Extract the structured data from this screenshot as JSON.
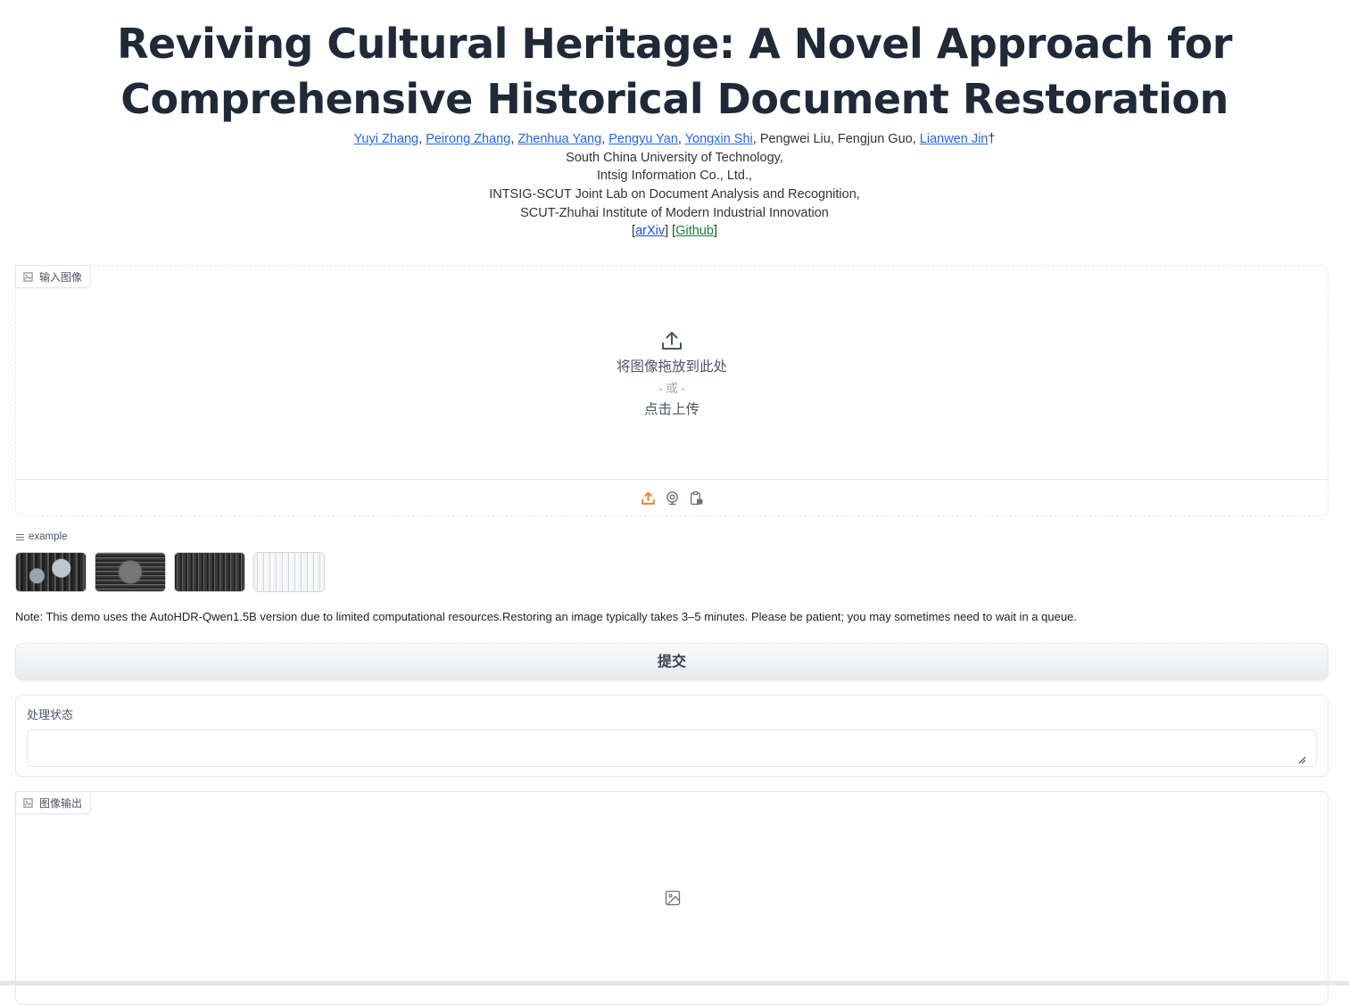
{
  "header": {
    "title_line1": "Reviving Cultural Heritage: A Novel Approach for",
    "title_line2": "Comprehensive Historical Document Restoration",
    "authors": [
      {
        "name": "Yuyi Zhang",
        "link": true
      },
      {
        "name": "Peirong Zhang",
        "link": true
      },
      {
        "name": "Zhenhua Yang",
        "link": true
      },
      {
        "name": "Pengyu Yan",
        "link": true
      },
      {
        "name": "Yongxin Shi",
        "link": true
      }
    ],
    "authors_plain": ", Pengwei Liu, Fengjun Guo, ",
    "last_author": "Lianwen Jin",
    "dagger": "†",
    "affiliations": [
      "South China University of Technology,",
      "Intsig Information Co., Ltd.,",
      "INTSIG-SCUT Joint Lab on Document Analysis and Recognition,",
      "SCUT-Zhuhai Institute of Modern Industrial Innovation"
    ],
    "links": {
      "arxiv": "arXiv",
      "github": "Github"
    }
  },
  "input_image": {
    "label": "输入图像",
    "drop_text": "将图像拖放到此处",
    "or_text": "- 或 -",
    "click_text": "点击上传",
    "sources": [
      "upload-icon",
      "webcam-icon",
      "clipboard-icon"
    ]
  },
  "examples": {
    "label": "example",
    "count": 4
  },
  "note": "Note: This demo uses the AutoHDR-Qwen1.5B version due to limited computational resources.Restoring an image typically takes 3–5 minutes. Please be patient; you may sometimes need to wait in a queue.",
  "submit_label": "提交",
  "status": {
    "label": "处理状态",
    "value": ""
  },
  "output_image": {
    "label": "图像输出"
  },
  "colors": {
    "accent": "#f97316",
    "link": "#2563eb",
    "github": "#15803d"
  }
}
